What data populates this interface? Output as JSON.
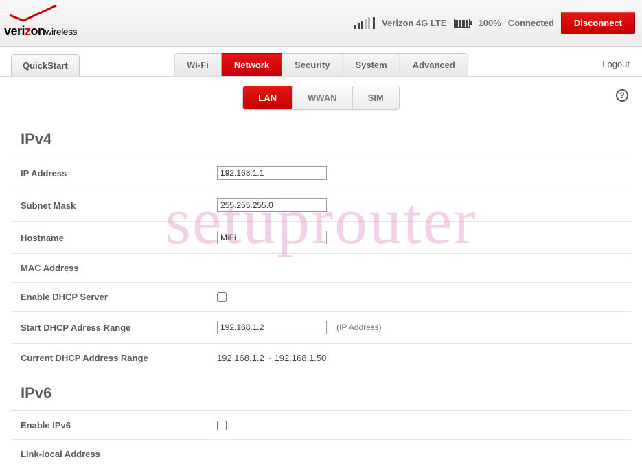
{
  "header": {
    "brand_pre": "veri",
    "brand_z": "z",
    "brand_post": "on",
    "brand_sub": "wireless",
    "carrier": "Verizon 4G LTE",
    "battery_pct": "100%",
    "conn_state": "Connected",
    "disconnect_label": "Disconnect"
  },
  "nav": {
    "quickstart": "QuickStart",
    "tabs": [
      {
        "label": "Wi-Fi"
      },
      {
        "label": "Network"
      },
      {
        "label": "Security"
      },
      {
        "label": "System"
      },
      {
        "label": "Advanced"
      }
    ],
    "logout": "Logout"
  },
  "subnav": {
    "tabs": [
      {
        "label": "LAN"
      },
      {
        "label": "WWAN"
      },
      {
        "label": "SIM"
      }
    ]
  },
  "watermark": "setuprouter",
  "sections": {
    "ipv4": {
      "title": "IPv4",
      "ip_label": "IP Address",
      "ip_value": "192.168.1.1",
      "subnet_label": "Subnet Mask",
      "subnet_value": "255.255.255.0",
      "host_label": "Hostname",
      "host_value": "MiFi",
      "mac_label": "MAC Address",
      "dhcp_enable_label": "Enable DHCP Server",
      "dhcp_start_label": "Start DHCP Adress Range",
      "dhcp_start_value": "192.168.1.2",
      "dhcp_start_hint": "(IP Address)",
      "dhcp_current_label": "Current DHCP Address Range",
      "dhcp_current_value": "192.168.1.2 ~ 192.168.1.50"
    },
    "ipv6": {
      "title": "IPv6",
      "enable_label": "Enable IPv6",
      "ll_label": "Link-local Address"
    }
  }
}
